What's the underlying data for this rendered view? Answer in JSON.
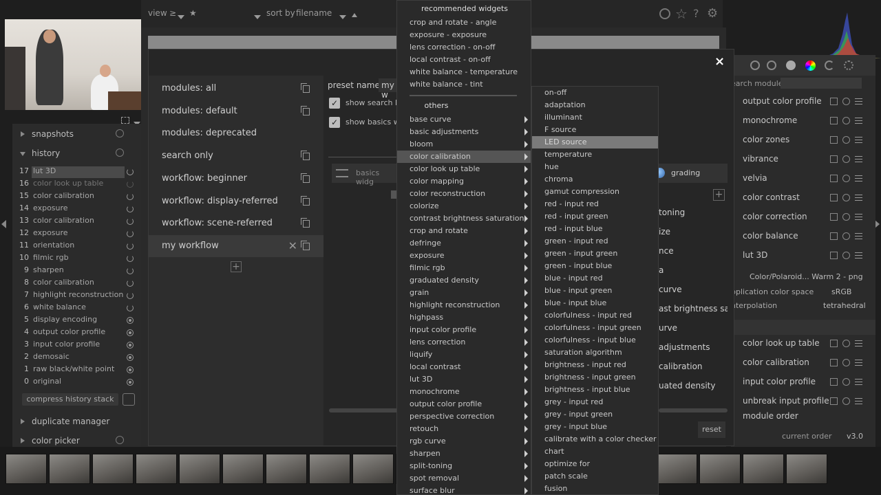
{
  "topbar": {
    "view_label": "view",
    "rating_filter": "≥",
    "star": "★",
    "sort_label": "sort by",
    "sort_value": "filename"
  },
  "left": {
    "snapshots": "snapshots",
    "history": "history",
    "history_items": [
      {
        "n": "17",
        "label": "lut 3D",
        "kind": "power"
      },
      {
        "n": "16",
        "label": "color look up table",
        "kind": "power-dim"
      },
      {
        "n": "15",
        "label": "color calibration",
        "kind": "power"
      },
      {
        "n": "14",
        "label": "exposure",
        "kind": "power"
      },
      {
        "n": "13",
        "label": "color calibration",
        "kind": "power"
      },
      {
        "n": "12",
        "label": "exposure",
        "kind": "power"
      },
      {
        "n": "11",
        "label": "orientation",
        "kind": "power"
      },
      {
        "n": "10",
        "label": "filmic rgb",
        "kind": "power"
      },
      {
        "n": "9",
        "label": "sharpen",
        "kind": "power"
      },
      {
        "n": "8",
        "label": "color calibration",
        "kind": "power"
      },
      {
        "n": "7",
        "label": "highlight reconstruction",
        "kind": "power"
      },
      {
        "n": "6",
        "label": "white balance",
        "kind": "power"
      },
      {
        "n": "5",
        "label": "display encoding",
        "kind": "dot"
      },
      {
        "n": "4",
        "label": "output color profile",
        "kind": "dot"
      },
      {
        "n": "3",
        "label": "input color profile",
        "kind": "dot"
      },
      {
        "n": "2",
        "label": "demosaic",
        "kind": "dot"
      },
      {
        "n": "1",
        "label": "raw black/white point",
        "kind": "dot"
      },
      {
        "n": "0",
        "label": "original",
        "kind": "dot"
      }
    ],
    "compress_button": "compress history stack",
    "duplicate_manager": "duplicate manager",
    "color_picker": "color picker"
  },
  "dialog": {
    "close": "×",
    "presets": [
      "modules: all",
      "modules: default",
      "modules: deprecated",
      "search only",
      "workflow: beginner",
      "workflow: display-referred",
      "workflow: scene-referred",
      "my workflow"
    ],
    "add_symbol": "+",
    "preset_name_label": "preset name :",
    "preset_name_value": "my w",
    "show_search_label": "show search li",
    "show_basics_label": "show basics w",
    "basics_tab": "basics widg",
    "grading_tab": "grading",
    "partial_modules": [
      "toning",
      "ize",
      "nce",
      "a",
      "curve",
      "ast brightness satur",
      "urve",
      "adjustments",
      "calibration",
      "uated density"
    ],
    "reset_button": "reset"
  },
  "menu1": {
    "header_recommended": "recommended widgets",
    "recommended": [
      "crop and rotate - angle",
      "exposure - exposure",
      "lens correction - on-off",
      "local contrast - on-off",
      "white balance - temperature",
      "white balance - tint"
    ],
    "header_others": "others",
    "others": [
      "base curve",
      "basic adjustments",
      "bloom",
      "color calibration",
      "color look up table",
      "color mapping",
      "color reconstruction",
      "colorize",
      "contrast brightness saturation",
      "crop and rotate",
      "defringe",
      "exposure",
      "filmic rgb",
      "graduated density",
      "grain",
      "highlight reconstruction",
      "highpass",
      "input color profile",
      "lens correction",
      "liquify",
      "local contrast",
      "lut 3D",
      "monochrome",
      "output color profile",
      "perspective correction",
      "retouch",
      "rgb curve",
      "sharpen",
      "split-toning",
      "spot removal",
      "surface blur"
    ],
    "selected_index": 3
  },
  "menu2": {
    "items": [
      "on-off",
      "adaptation",
      "illuminant",
      "F source",
      "LED source",
      "temperature",
      "hue",
      "chroma",
      "gamut compression",
      "red - input red",
      "red - input green",
      "red - input blue",
      "green - input red",
      "green - input green",
      "green - input blue",
      "blue - input red",
      "blue - input green",
      "blue - input blue",
      "colorfulness - input red",
      "colorfulness - input green",
      "colorfulness - input blue",
      "saturation algorithm",
      "brightness - input red",
      "brightness - input green",
      "brightness - input blue",
      "grey - input red",
      "grey - input green",
      "grey - input blue",
      "calibrate with a color checker",
      "chart",
      "optimize for",
      "patch scale",
      "fusion"
    ],
    "selected_index": 4
  },
  "right": {
    "search_placeholder": "earch module",
    "modules": [
      "output color profile",
      "monochrome",
      "color zones",
      "vibrance",
      "velvia",
      "color contrast",
      "color correction",
      "color balance",
      "lut 3D"
    ],
    "lut_file": "Color/Polaroid... Warm 2 - png",
    "app_color_space_label": "pplication color space",
    "app_color_space_value": "sRGB",
    "interpolation_label": "nterpolation",
    "interpolation_value": "tetrahedral",
    "modules2": [
      "color look up table",
      "color calibration",
      "input color profile",
      "unbreak input profile"
    ],
    "module_order": "module order",
    "current_order_label": "current order",
    "current_order_value": "v3.0"
  }
}
